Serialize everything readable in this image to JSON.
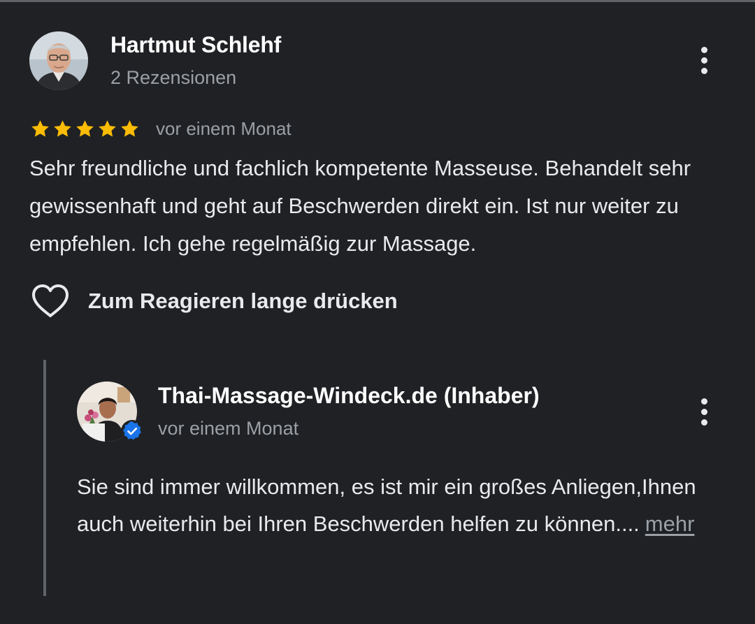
{
  "review": {
    "reviewer_name": "Hartmut Schlehf",
    "reviewer_meta": "2 Rezensionen",
    "rating": 5,
    "rating_max": 5,
    "date": "vor einem Monat",
    "text": "Sehr freundliche und fachlich kompetente Masseuse. Behandelt sehr gewissenhaft und geht auf Beschwerden direkt ein. Ist nur weiter zu empfehlen. Ich gehe regelmäßig zur Massage.",
    "react_label": "Zum Reagieren lange drücken",
    "react_icon": "heart-outline-icon",
    "menu_icon": "more-vert-icon"
  },
  "owner_reply": {
    "name": "Thai-Massage-Windeck.de (Inhaber)",
    "date": "vor einem Monat",
    "text": "Sie sind immer willkommen, es ist mir ein großes Anliegen,Ihnen auch weiterhin bei Ihren Beschwerden helfen zu können....",
    "more_label": "mehr",
    "verified_icon": "verified-badge-icon",
    "menu_icon": "more-vert-icon"
  },
  "colors": {
    "background": "#202124",
    "text_primary": "#e8eaed",
    "text_secondary": "#9aa0a6",
    "star": "#fbbc04",
    "verified": "#1a73e8",
    "reply_bar": "#5f6368"
  }
}
